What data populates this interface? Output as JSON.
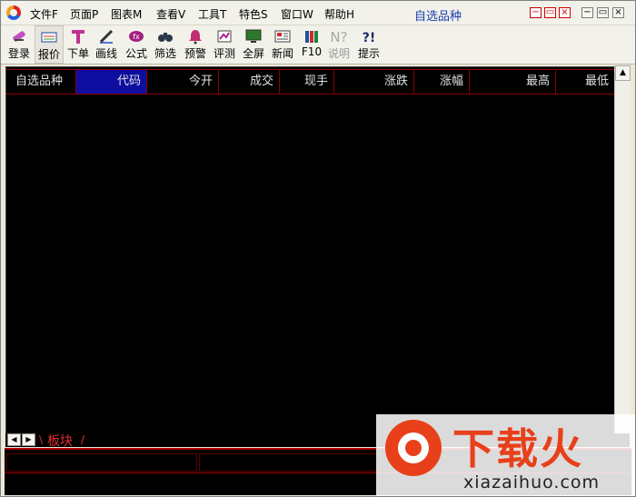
{
  "menubar": {
    "items": [
      {
        "label": "文件F"
      },
      {
        "label": "页面P"
      },
      {
        "label": "图表M"
      },
      {
        "label": "查看V"
      },
      {
        "label": "工具T"
      },
      {
        "label": "特色S"
      },
      {
        "label": "窗口W"
      },
      {
        "label": "帮助H"
      }
    ],
    "window_title": "自选品种",
    "controls": {
      "minimize": "−",
      "restore": "▭",
      "close": "×"
    }
  },
  "toolbar": {
    "items": [
      {
        "label": "登录",
        "icon": "login-icon"
      },
      {
        "label": "报价",
        "icon": "quote-icon"
      },
      {
        "label": "下单",
        "icon": "order-icon"
      },
      {
        "label": "画线",
        "icon": "draw-line-icon"
      },
      {
        "label": "公式",
        "icon": "formula-icon"
      },
      {
        "label": "筛选",
        "icon": "filter-binoculars-icon"
      },
      {
        "label": "预警",
        "icon": "alarm-bell-icon"
      },
      {
        "label": "评测",
        "icon": "evaluate-icon"
      },
      {
        "label": "全屏",
        "icon": "fullscreen-monitor-icon"
      },
      {
        "label": "新闻",
        "icon": "news-icon"
      },
      {
        "label": "F10",
        "icon": "books-icon"
      },
      {
        "label": "说明",
        "icon": "help-question-icon"
      },
      {
        "label": "提示",
        "icon": "tips-icon"
      }
    ]
  },
  "grid": {
    "columns": [
      "自选品种",
      "代码",
      "今开",
      "成交",
      "现手",
      "涨跌",
      "涨幅",
      "最高",
      "最低"
    ]
  },
  "bottom_tabs": {
    "board_label": "板块"
  },
  "watermark": {
    "cn": "下载火",
    "en": "xiazaihuo.com"
  },
  "colors": {
    "grid_bg": "#000000",
    "grid_line": "#8b0000",
    "selected_header": "#0d0da0",
    "header_text": "#e0e0e0",
    "title_text": "#1a3fb0",
    "board_tab": "#e03030",
    "watermark_brand": "#e8401a"
  }
}
